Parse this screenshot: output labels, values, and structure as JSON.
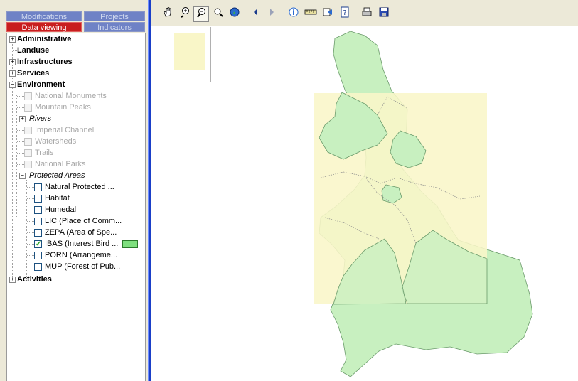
{
  "tabs": {
    "modifications": "Modifications",
    "projects": "Projects",
    "data_viewing": "Data viewing",
    "indicators": "Indicators"
  },
  "tree": {
    "administrative": "Administrative",
    "landuse": "Landuse",
    "infrastructures": "Infrastructures",
    "services": "Services",
    "environment": "Environment",
    "national_monuments": "National Monuments",
    "mountain_peaks": "Mountain Peaks",
    "rivers": "Rivers",
    "imperial_channel": "Imperial Channel",
    "watersheds": "Watersheds",
    "trails": "Trails",
    "national_parks": "National Parks",
    "protected_areas": "Protected Areas",
    "natural_protected": "Natural Protected ...",
    "habitat": "Habitat",
    "humedal": "Humedal",
    "lic": "LIC (Place of Comm...",
    "zepa": "ZEPA (Area of Spe...",
    "ibas": "IBAS (Interest Bird ...",
    "porn": "PORN (Arrangeme...",
    "mup": "MUP (Forest of Pub...",
    "activities": "Activities"
  },
  "toolbar_icons": [
    "hand-pan-icon",
    "zoom-in-icon",
    "zoom-out-icon",
    "zoom-extent-icon",
    "globe-icon",
    "back-arrow-icon",
    "forward-arrow-icon",
    "info-icon",
    "measure-icon",
    "print-layout-icon",
    "help-icon",
    "print-icon",
    "save-icon"
  ],
  "colors": {
    "ibas_fill": "#c8f0c0",
    "overlay_fill": "#f9f6c8",
    "legend_green": "#7ee07e",
    "selected_tab": "#c81e1e",
    "divider": "#1a3fc8"
  },
  "ibas_checked": true
}
